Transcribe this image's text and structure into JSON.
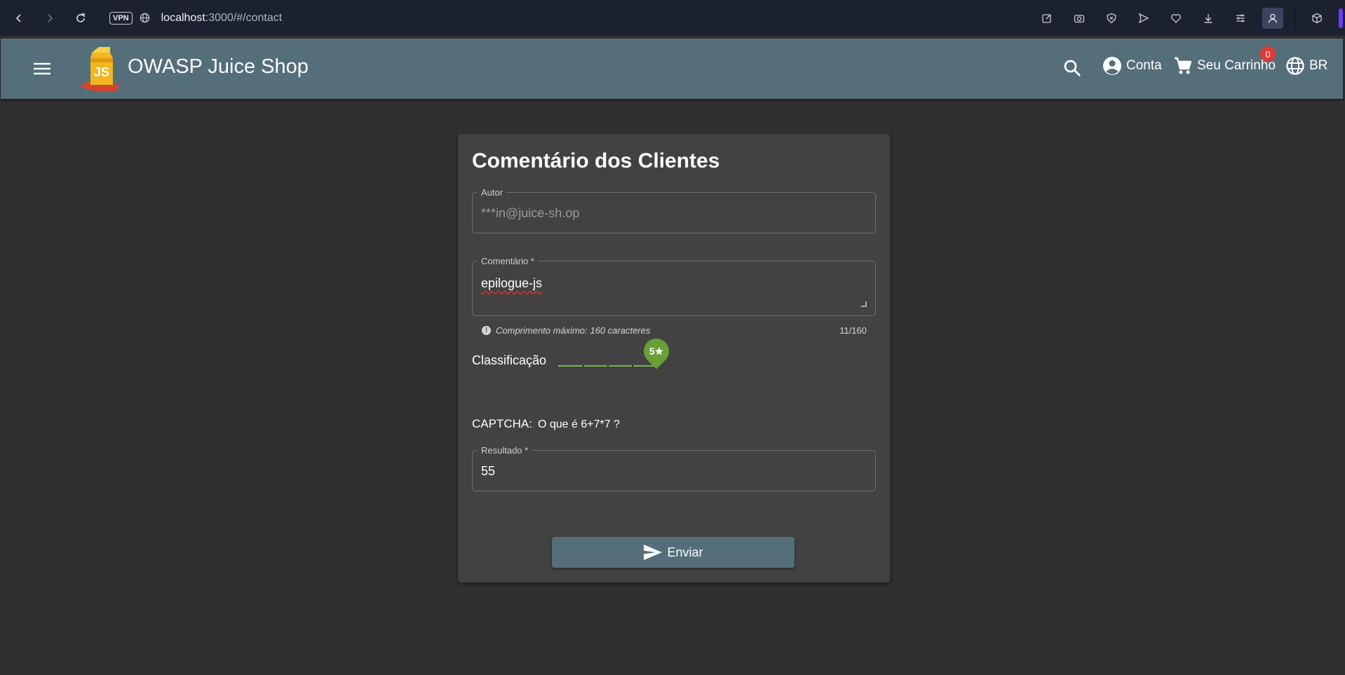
{
  "browser": {
    "vpn_label": "VPN",
    "url_host": "localhost",
    "url_path": ":3000/#/contact"
  },
  "app": {
    "title": "OWASP Juice Shop",
    "account_label": "Conta",
    "cart_label": "Seu Carrinho",
    "cart_count": "0",
    "language_label": "BR"
  },
  "feedback": {
    "title": "Comentário dos Clientes",
    "author_label": "Autor",
    "author_value": "***in@juice-sh.op",
    "comment_label": "Comentário *",
    "comment_value": "epilogue-js",
    "comment_hint": "Comprimento máximo: 160 caracteres",
    "comment_counter": "11/160",
    "rating_label": "Classificação",
    "rating_value_label": "5★",
    "rating": {
      "value": 5,
      "min": 1,
      "max": 5
    },
    "captcha_label": "CAPTCHA:",
    "captcha_question": "O que é  6+7*7 ?",
    "result_label": "Resultado *",
    "result_value": "55",
    "submit_label": "Enviar"
  },
  "colors": {
    "toolbar": "#546e7a",
    "background": "#303030",
    "card": "#424242",
    "slider_accent": "#689f38",
    "badge": "#e53935"
  }
}
